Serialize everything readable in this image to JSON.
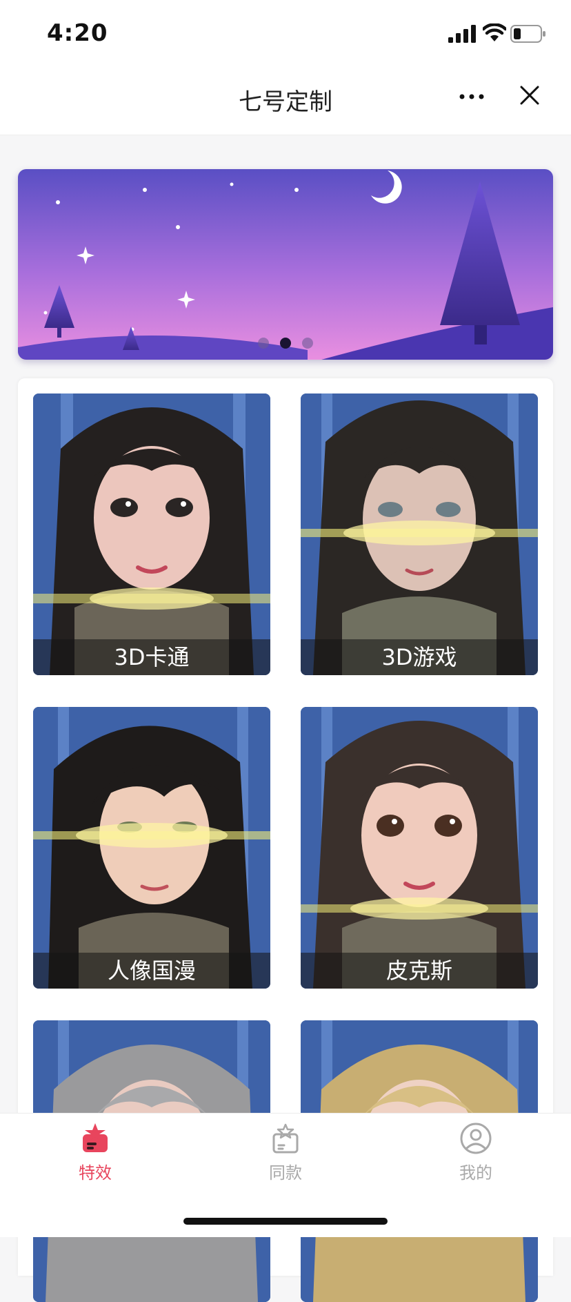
{
  "status_bar": {
    "time": "4:20"
  },
  "header": {
    "title": "七号定制"
  },
  "banner": {
    "page_count": 3,
    "active_page": 2
  },
  "effects": [
    {
      "label": "3D卡通"
    },
    {
      "label": "3D游戏"
    },
    {
      "label": "人像国漫"
    },
    {
      "label": "皮克斯"
    },
    {
      "label": ""
    },
    {
      "label": ""
    }
  ],
  "tabs": [
    {
      "label": "特效",
      "icon": "effects-icon",
      "active": true
    },
    {
      "label": "同款",
      "icon": "same-style-icon",
      "active": false
    },
    {
      "label": "我的",
      "icon": "profile-icon",
      "active": false
    }
  ],
  "colors": {
    "accent": "#e8455d",
    "inactive_tab": "#a9a9a9"
  }
}
